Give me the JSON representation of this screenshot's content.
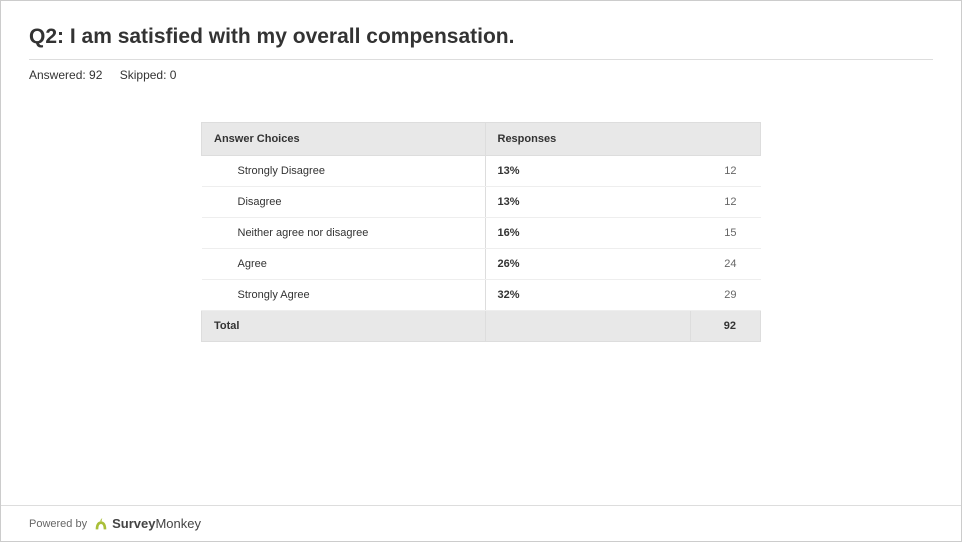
{
  "question": {
    "title": "Q2: I am satisfied with my overall compensation.",
    "answered_label": "Answered: 92",
    "skipped_label": "Skipped: 0"
  },
  "table": {
    "header_choices": "Answer Choices",
    "header_responses": "Responses",
    "rows": [
      {
        "label": "Strongly Disagree",
        "percent": "13%",
        "count": "12"
      },
      {
        "label": "Disagree",
        "percent": "13%",
        "count": "12"
      },
      {
        "label": "Neither agree nor disagree",
        "percent": "16%",
        "count": "15"
      },
      {
        "label": "Agree",
        "percent": "26%",
        "count": "24"
      },
      {
        "label": "Strongly Agree",
        "percent": "32%",
        "count": "29"
      }
    ],
    "total_label": "Total",
    "total_count": "92"
  },
  "footer": {
    "powered_by": "Powered by",
    "brand_bold": "Survey",
    "brand_rest": "Monkey"
  }
}
